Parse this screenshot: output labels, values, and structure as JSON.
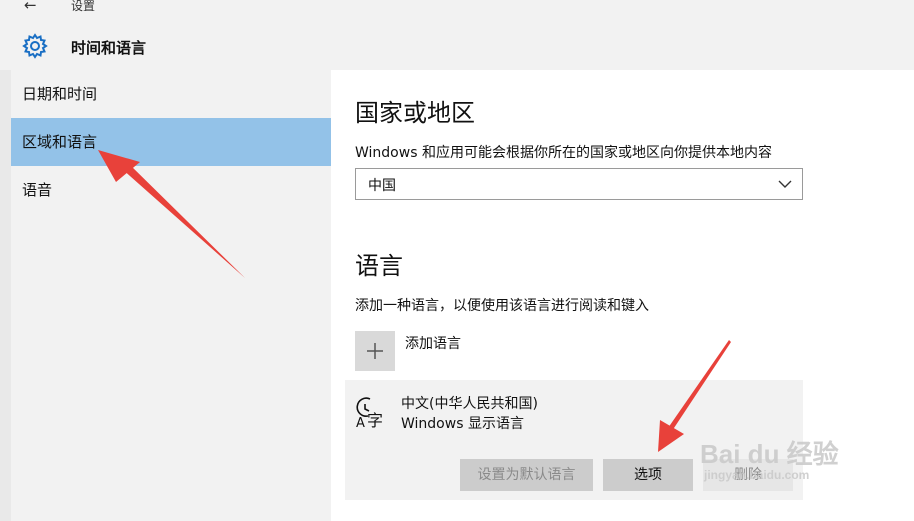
{
  "header": {
    "back_label": "←",
    "settings_label": "设置",
    "app_title": "时间和语言"
  },
  "sidebar": {
    "items": [
      {
        "label": "日期和时间",
        "active": false
      },
      {
        "label": "区域和语言",
        "active": true
      },
      {
        "label": "语音",
        "active": false
      }
    ]
  },
  "region": {
    "heading": "国家或地区",
    "description": "Windows 和应用可能会根据你所在的国家或地区向你提供本地内容",
    "selected": "中国"
  },
  "language": {
    "heading": "语言",
    "description": "添加一种语言，以便使用该语言进行阅读和键入",
    "add_label": "添加语言",
    "entry_name": "中文(中华人民共和国)",
    "entry_sub": "Windows 显示语言",
    "set_default_label": "设置为默认语言",
    "options_label": "选项",
    "remove_label": "删除"
  },
  "watermark": {
    "main": "Bai du 经验",
    "sub": "jingyan.baidu.com"
  },
  "colors": {
    "accent": "#93c2e8",
    "sidebar_bg": "#f2f2f2",
    "annotation_arrow": "#e8413a"
  }
}
